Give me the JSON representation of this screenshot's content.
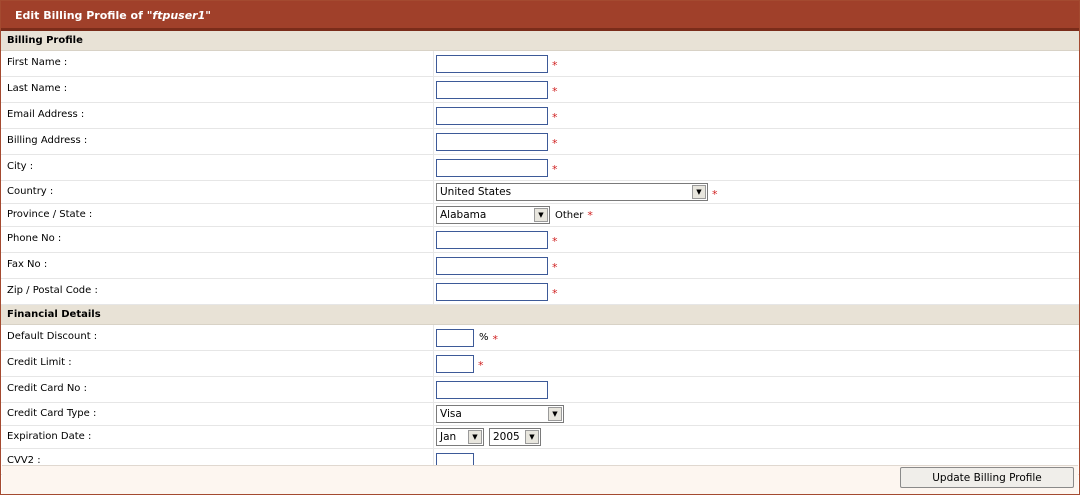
{
  "title": {
    "prefix": "Edit Billing Profile of ",
    "username": "\"ftpuser1\""
  },
  "sections": {
    "billing": "Billing Profile",
    "financial": "Financial Details"
  },
  "required_mark": "*",
  "billing_fields": {
    "first_name": {
      "label": "First Name :",
      "value": ""
    },
    "last_name": {
      "label": "Last Name :",
      "value": ""
    },
    "email": {
      "label": "Email Address :",
      "value": ""
    },
    "billing_address": {
      "label": "Billing Address :",
      "value": ""
    },
    "city": {
      "label": "City :",
      "value": ""
    },
    "country": {
      "label": "Country :",
      "selected": "United States"
    },
    "province": {
      "label": "Province / State :",
      "selected": "Alabama",
      "other_label": "Other"
    },
    "phone": {
      "label": "Phone No :",
      "value": ""
    },
    "fax": {
      "label": "Fax No :",
      "value": ""
    },
    "zip": {
      "label": "Zip / Postal Code :",
      "value": ""
    }
  },
  "financial_fields": {
    "default_discount": {
      "label": "Default Discount :",
      "value": "",
      "suffix": "%"
    },
    "credit_limit": {
      "label": "Credit Limit :",
      "value": ""
    },
    "credit_card_no": {
      "label": "Credit Card No :",
      "value": ""
    },
    "credit_card_type": {
      "label": "Credit Card Type :",
      "selected": "Visa"
    },
    "expiration_date": {
      "label": "Expiration Date :",
      "month": "Jan",
      "year": "2005"
    },
    "cvv2": {
      "label": "CVV2 :",
      "value": ""
    }
  },
  "actions": {
    "update_label": "Update Billing Profile"
  },
  "colors": {
    "title_bg": "#a0402a",
    "section_bg": "#e8e2d6",
    "required": "#d02020",
    "input_border": "#3d5a98"
  },
  "icons": {
    "dropdown": "triangle-down"
  }
}
